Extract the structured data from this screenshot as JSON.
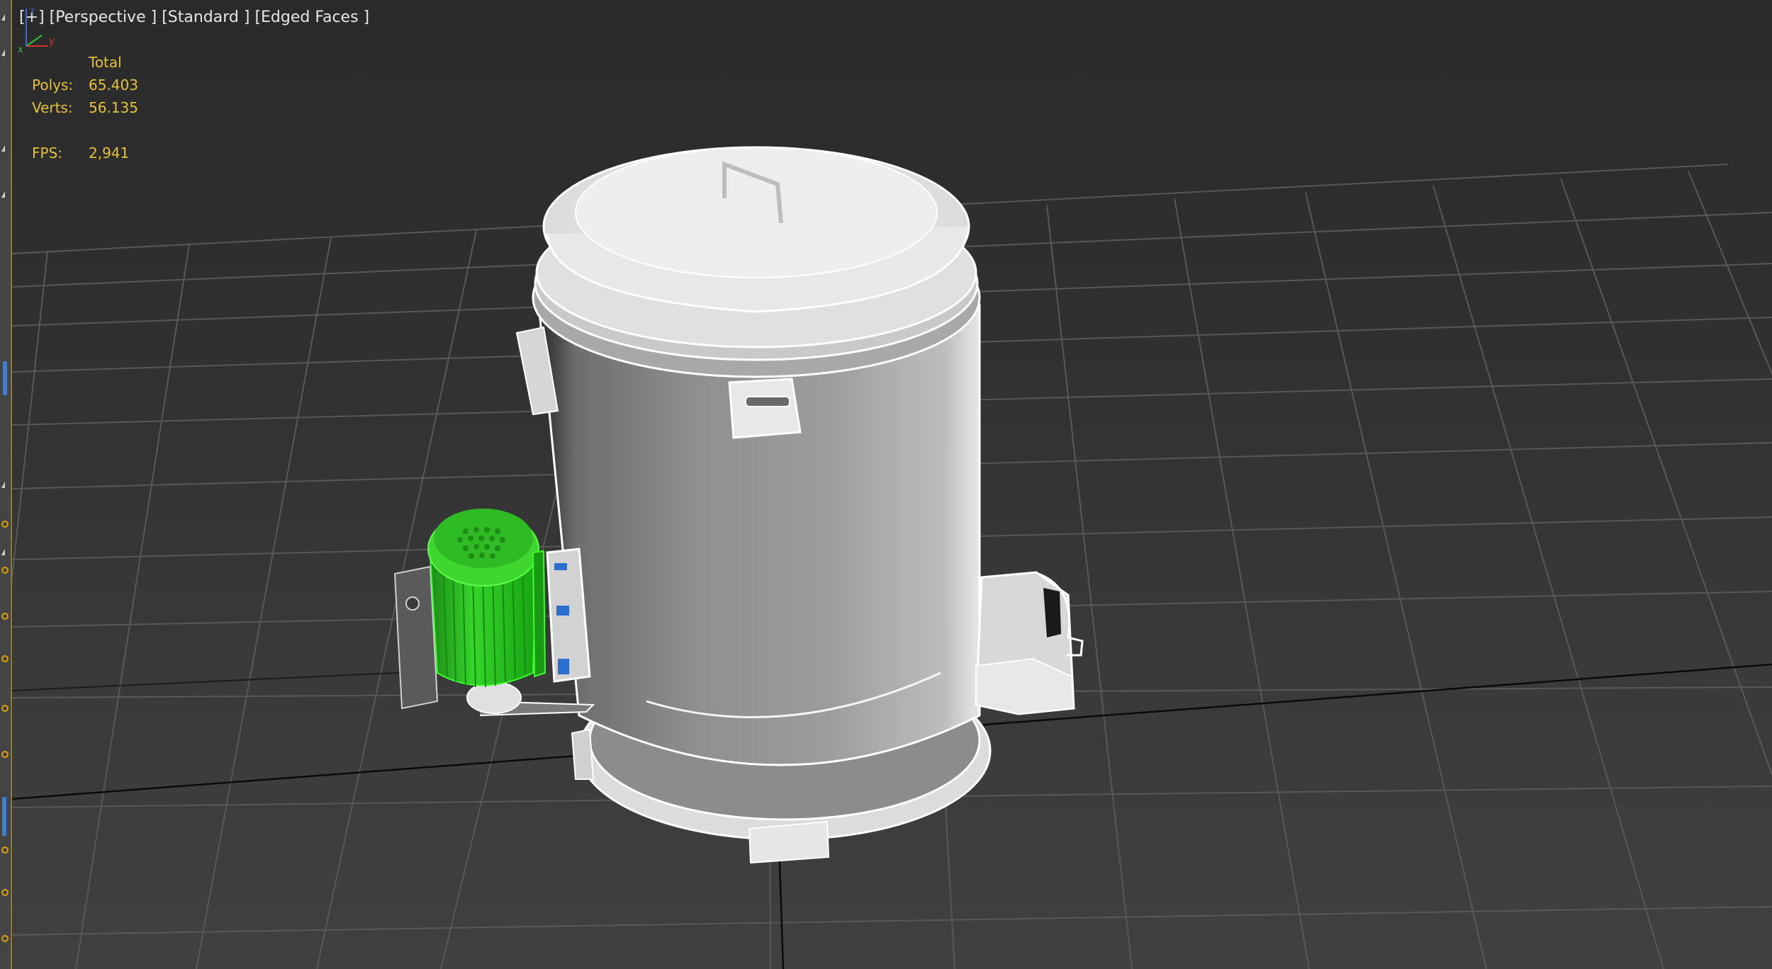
{
  "viewport": {
    "label_plus": "[+]",
    "label_view": "[Perspective ]",
    "label_shading": "[Standard ]",
    "label_edges": "[Edged Faces ]"
  },
  "stats": {
    "header": "Total",
    "polys_label": "Polys:",
    "polys_value": "65.403",
    "verts_label": "Verts:",
    "verts_value": "56.135",
    "fps_label": "FPS:",
    "fps_value": "2,941"
  },
  "axis": {
    "x": "x",
    "y": "y",
    "z": "z"
  },
  "colors": {
    "stats_text": "#e2c23a",
    "selected_object": "#27c41e",
    "model_white": "#e9e9e9",
    "grid_line": "#5a5a5a"
  }
}
